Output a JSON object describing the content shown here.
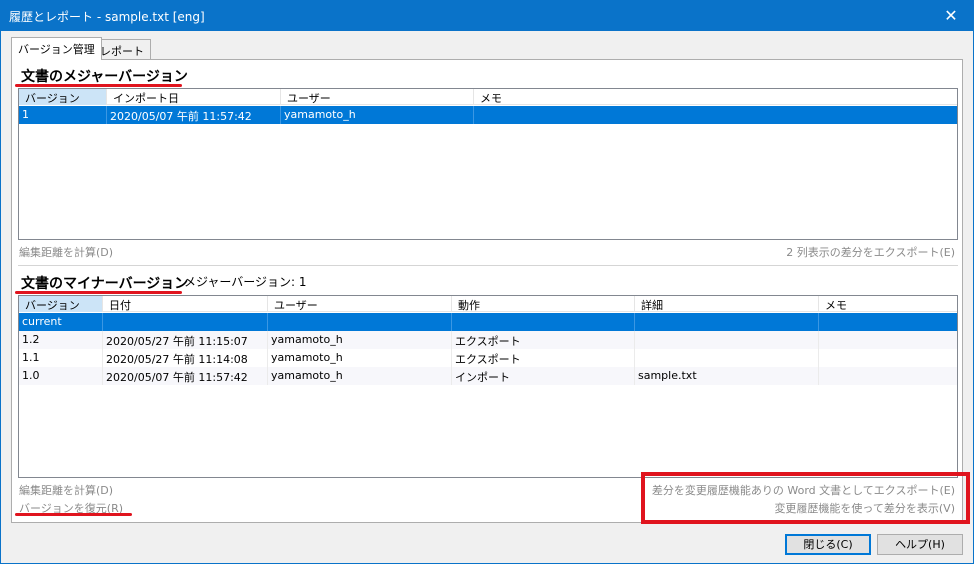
{
  "window": {
    "title": "履歴とレポート - sample.txt [eng]",
    "close_glyph": "✕"
  },
  "tabs": [
    {
      "label": "バージョン管理",
      "active": true
    },
    {
      "label": "レポート",
      "active": false
    }
  ],
  "major": {
    "title": "文書のメジャーバージョン",
    "columns": [
      "バージョン",
      "インポート日",
      "ユーザー",
      "メモ"
    ],
    "rows": [
      {
        "version": "1",
        "date": "2020/05/07 午前 11:57:42",
        "user": "yamamoto_h",
        "memo": ""
      }
    ],
    "calc_distance": "編集距離を計算(D)",
    "export_two_col": "2 列表示の差分をエクスポート(E)"
  },
  "minor": {
    "title": "文書のマイナーバージョン",
    "major_version_label": "メジャーバージョン: 1",
    "columns": [
      "バージョン",
      "日付",
      "ユーザー",
      "動作",
      "詳細",
      "メモ"
    ],
    "rows": [
      {
        "version": "current",
        "date": "",
        "user": "",
        "action": "",
        "detail": "",
        "memo": ""
      },
      {
        "version": "1.2",
        "date": "2020/05/27 午前 11:15:07",
        "user": "yamamoto_h",
        "action": "エクスポート",
        "detail": "",
        "memo": ""
      },
      {
        "version": "1.1",
        "date": "2020/05/27 午前 11:14:08",
        "user": "yamamoto_h",
        "action": "エクスポート",
        "detail": "",
        "memo": ""
      },
      {
        "version": "1.0",
        "date": "2020/05/07 午前 11:57:42",
        "user": "yamamoto_h",
        "action": "インポート",
        "detail": "sample.txt",
        "memo": ""
      }
    ],
    "calc_distance": "編集距離を計算(D)",
    "restore_version": "バージョンを復元(R)",
    "export_word": "差分を変更履歴機能ありの Word 文書としてエクスポート(E)",
    "show_diff": "変更履歴機能を使って差分を表示(V)"
  },
  "buttons": {
    "close": "閉じる(C)",
    "help": "ヘルプ(H)"
  },
  "colors": {
    "titlebar": "#0a73c9",
    "selection": "#0078d7",
    "annotation_red": "#e0141e"
  }
}
